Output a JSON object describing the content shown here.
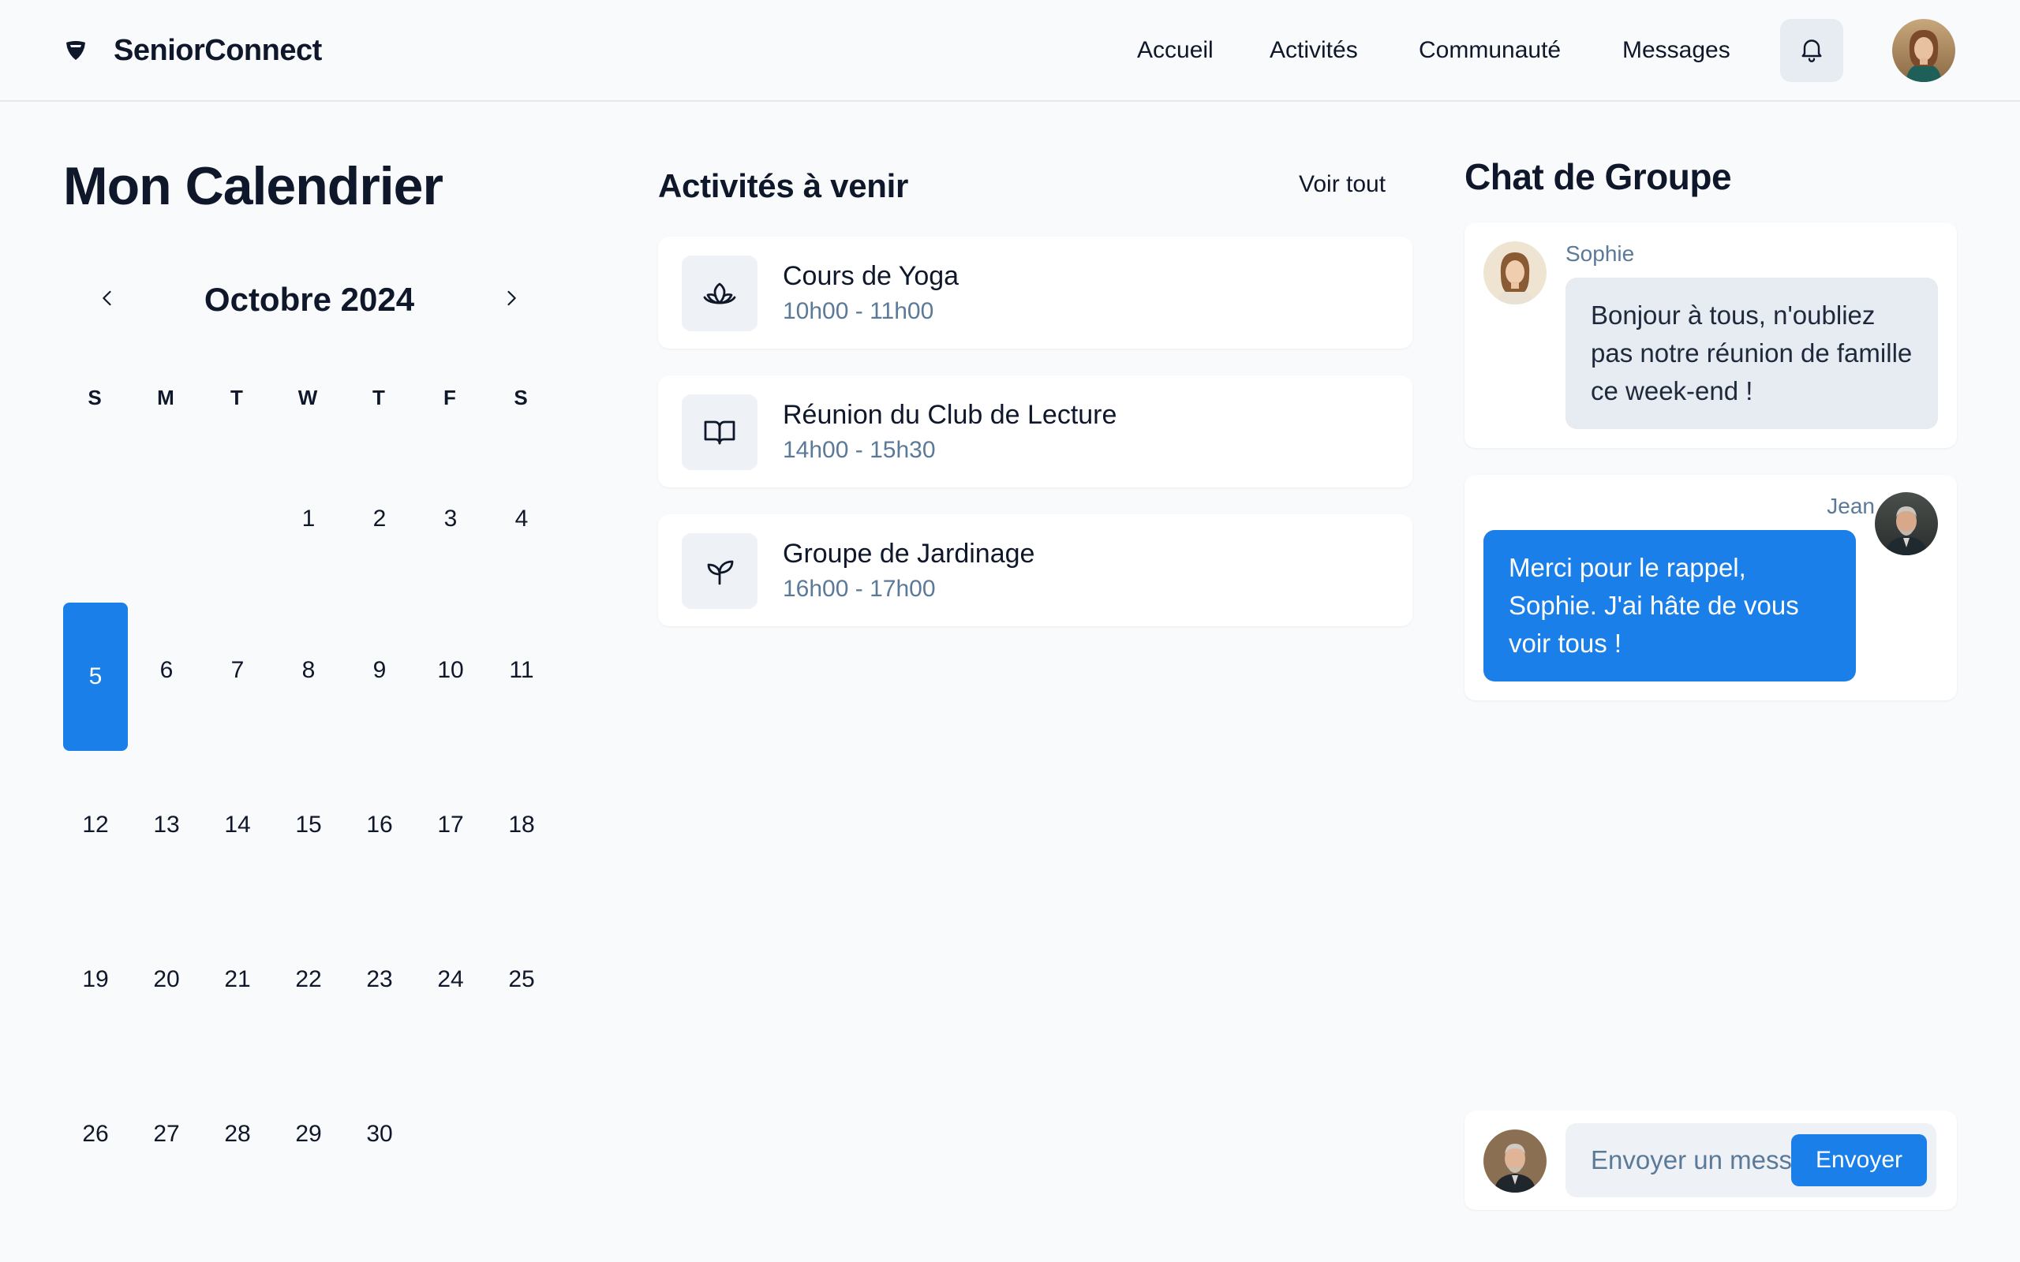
{
  "brand": {
    "name": "SeniorConnect",
    "logo_icon": "shield-heart-icon"
  },
  "nav": {
    "items": [
      {
        "label": "Accueil"
      },
      {
        "label": "Activités"
      },
      {
        "label": "Communauté"
      },
      {
        "label": "Messages"
      }
    ],
    "notification_icon": "bell-icon"
  },
  "calendar": {
    "title": "Mon Calendrier",
    "month_label": "Octobre 2024",
    "weekdays": [
      "S",
      "M",
      "T",
      "W",
      "T",
      "F",
      "S"
    ],
    "selected_day": "5",
    "days": [
      "1",
      "2",
      "3",
      "4",
      "5",
      "6",
      "7",
      "8",
      "9",
      "10",
      "11",
      "12",
      "13",
      "14",
      "15",
      "16",
      "17",
      "18",
      "19",
      "20",
      "21",
      "22",
      "23",
      "24",
      "25",
      "26",
      "27",
      "28",
      "29",
      "30"
    ]
  },
  "activities": {
    "title": "Activités à venir",
    "see_all": "Voir tout",
    "items": [
      {
        "name": "Cours de Yoga",
        "time": "10h00 - 11h00",
        "icon": "lotus-icon"
      },
      {
        "name": "Réunion du Club de Lecture",
        "time": "14h00 - 15h30",
        "icon": "book-icon"
      },
      {
        "name": "Groupe de Jardinage",
        "time": "16h00 - 17h00",
        "icon": "sprout-icon"
      }
    ]
  },
  "chat": {
    "title": "Chat de Groupe",
    "messages": [
      {
        "sender": "Sophie",
        "text": "Bonjour à tous, n'oubliez pas notre réunion de famille ce week-end !"
      },
      {
        "sender": "Jean",
        "text": "Merci pour le rappel, Sophie. J'ai hâte de vous voir tous !"
      }
    ],
    "input_placeholder": "Envoyer un message...",
    "send_label": "Envoyer"
  },
  "colors": {
    "accent": "#1a7fe8",
    "muted_text": "#5b7a99",
    "background": "#f8fafc",
    "bubble_in": "#e7ebf2"
  }
}
